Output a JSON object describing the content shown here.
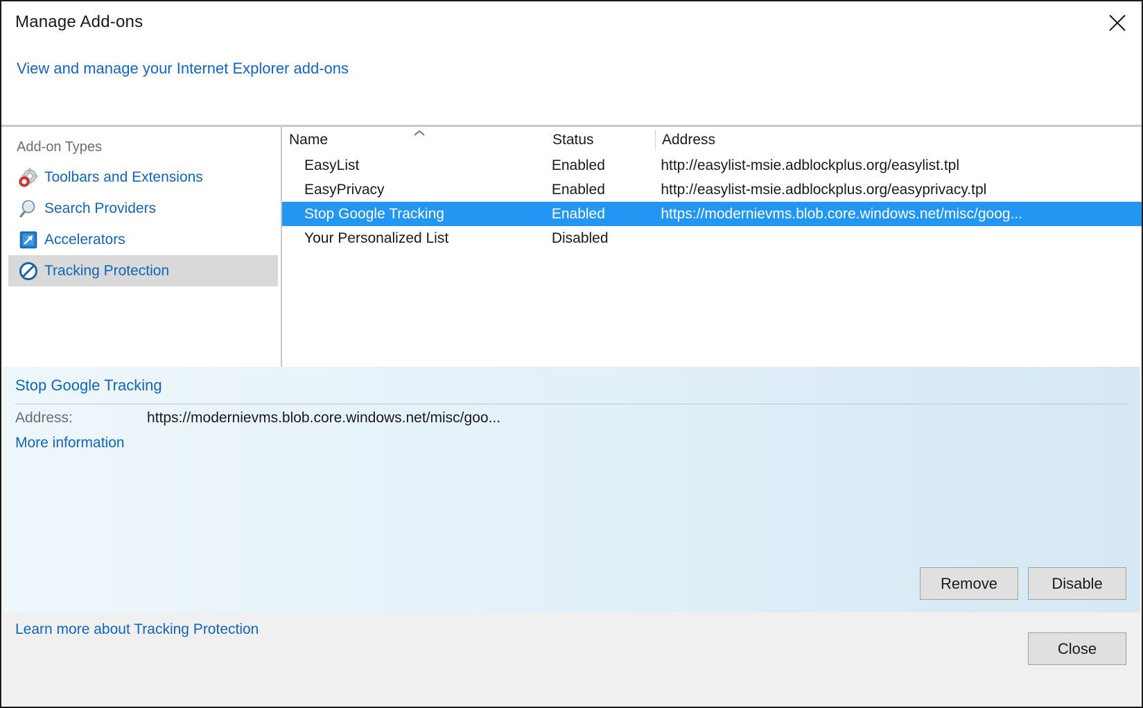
{
  "window": {
    "title": "Manage Add-ons",
    "close_icon": "close-icon",
    "header_link": "View and manage your Internet Explorer add-ons"
  },
  "sidebar": {
    "title": "Add-on Types",
    "items": [
      {
        "label": "Toolbars and Extensions",
        "icon": "gear-blocked-icon",
        "selected": false
      },
      {
        "label": "Search Providers",
        "icon": "magnifier-icon",
        "selected": false
      },
      {
        "label": "Accelerators",
        "icon": "arrow-box-icon",
        "selected": false
      },
      {
        "label": "Tracking Protection",
        "icon": "no-entry-icon",
        "selected": true
      }
    ]
  },
  "list": {
    "columns": [
      "Name",
      "Status",
      "Address"
    ],
    "sort_column": "Name",
    "sort_direction": "ascending",
    "sort_icon": "chevron-up-icon",
    "rows": [
      {
        "name": "EasyList",
        "status": "Enabled",
        "address": "http://easylist-msie.adblockplus.org/easylist.tpl",
        "selected": false
      },
      {
        "name": "EasyPrivacy",
        "status": "Enabled",
        "address": "http://easylist-msie.adblockplus.org/easyprivacy.tpl",
        "selected": false
      },
      {
        "name": "Stop Google Tracking",
        "status": "Enabled",
        "address": "https://modernievms.blob.core.windows.net/misc/goog...",
        "selected": true
      },
      {
        "name": "Your Personalized List",
        "status": "Disabled",
        "address": "",
        "selected": false
      }
    ]
  },
  "details": {
    "title": "Stop Google Tracking",
    "address_label": "Address:",
    "address_value": "https://modernievms.blob.core.windows.net/misc/goo...",
    "more_information": "More information",
    "remove_label": "Remove",
    "disable_label": "Disable"
  },
  "footer": {
    "learn_more": "Learn more about Tracking Protection",
    "close_label": "Close"
  },
  "colors": {
    "link": "#1165bf",
    "selection": "#2196f3",
    "sidebar_selected": "#d9d9d9",
    "button_face": "#e0e0e0",
    "footer_bg": "#f0f0f0"
  }
}
